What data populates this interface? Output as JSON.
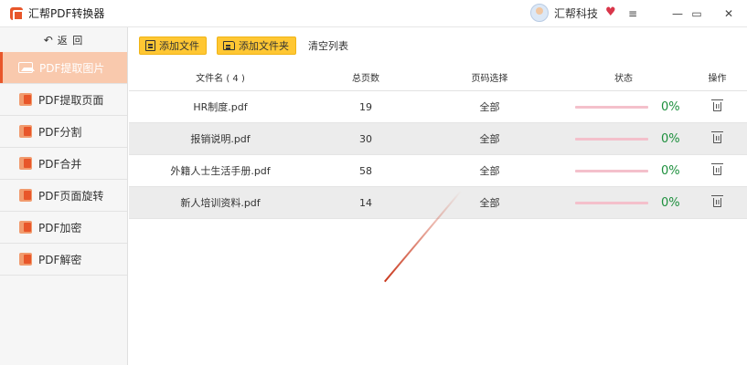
{
  "app": {
    "title": "汇帮PDF转换器"
  },
  "brand": {
    "name": "汇帮科技"
  },
  "sidebar": {
    "back_icon": "↶",
    "back_label": "返 回",
    "items": [
      {
        "label": "PDF提取图片",
        "icon": "image-icon",
        "active": true
      },
      {
        "label": "PDF提取页面",
        "icon": "pdf-icon"
      },
      {
        "label": "PDF分割",
        "icon": "pdf-icon"
      },
      {
        "label": "PDF合并",
        "icon": "pdf-icon"
      },
      {
        "label": "PDF页面旋转",
        "icon": "pdf-icon"
      },
      {
        "label": "PDF加密",
        "icon": "pdf-icon"
      },
      {
        "label": "PDF解密",
        "icon": "pdf-icon"
      }
    ]
  },
  "toolbar": {
    "add_file_label": "添加文件",
    "add_folder_label": "添加文件夹",
    "clear_label": "清空列表"
  },
  "table": {
    "headers": {
      "name": "文件名 ( 4 )",
      "pages": "总页数",
      "range": "页码选择",
      "status": "状态",
      "op": "操作"
    },
    "rows": [
      {
        "name": "HR制度.pdf",
        "pages": "19",
        "range": "全部",
        "progress": 0,
        "status": "0%"
      },
      {
        "name": "报销说明.pdf",
        "pages": "30",
        "range": "全部",
        "progress": 0,
        "status": "0%"
      },
      {
        "name": "外籍人士生活手册.pdf",
        "pages": "58",
        "range": "全部",
        "progress": 0,
        "status": "0%"
      },
      {
        "name": "新人培训资料.pdf",
        "pages": "14",
        "range": "全部",
        "progress": 0,
        "status": "0%"
      }
    ]
  },
  "colors": {
    "accent": "#e8562a",
    "active_bg": "#f9c9ad",
    "button": "#ffc733",
    "progress_text": "#1c8f3c"
  }
}
